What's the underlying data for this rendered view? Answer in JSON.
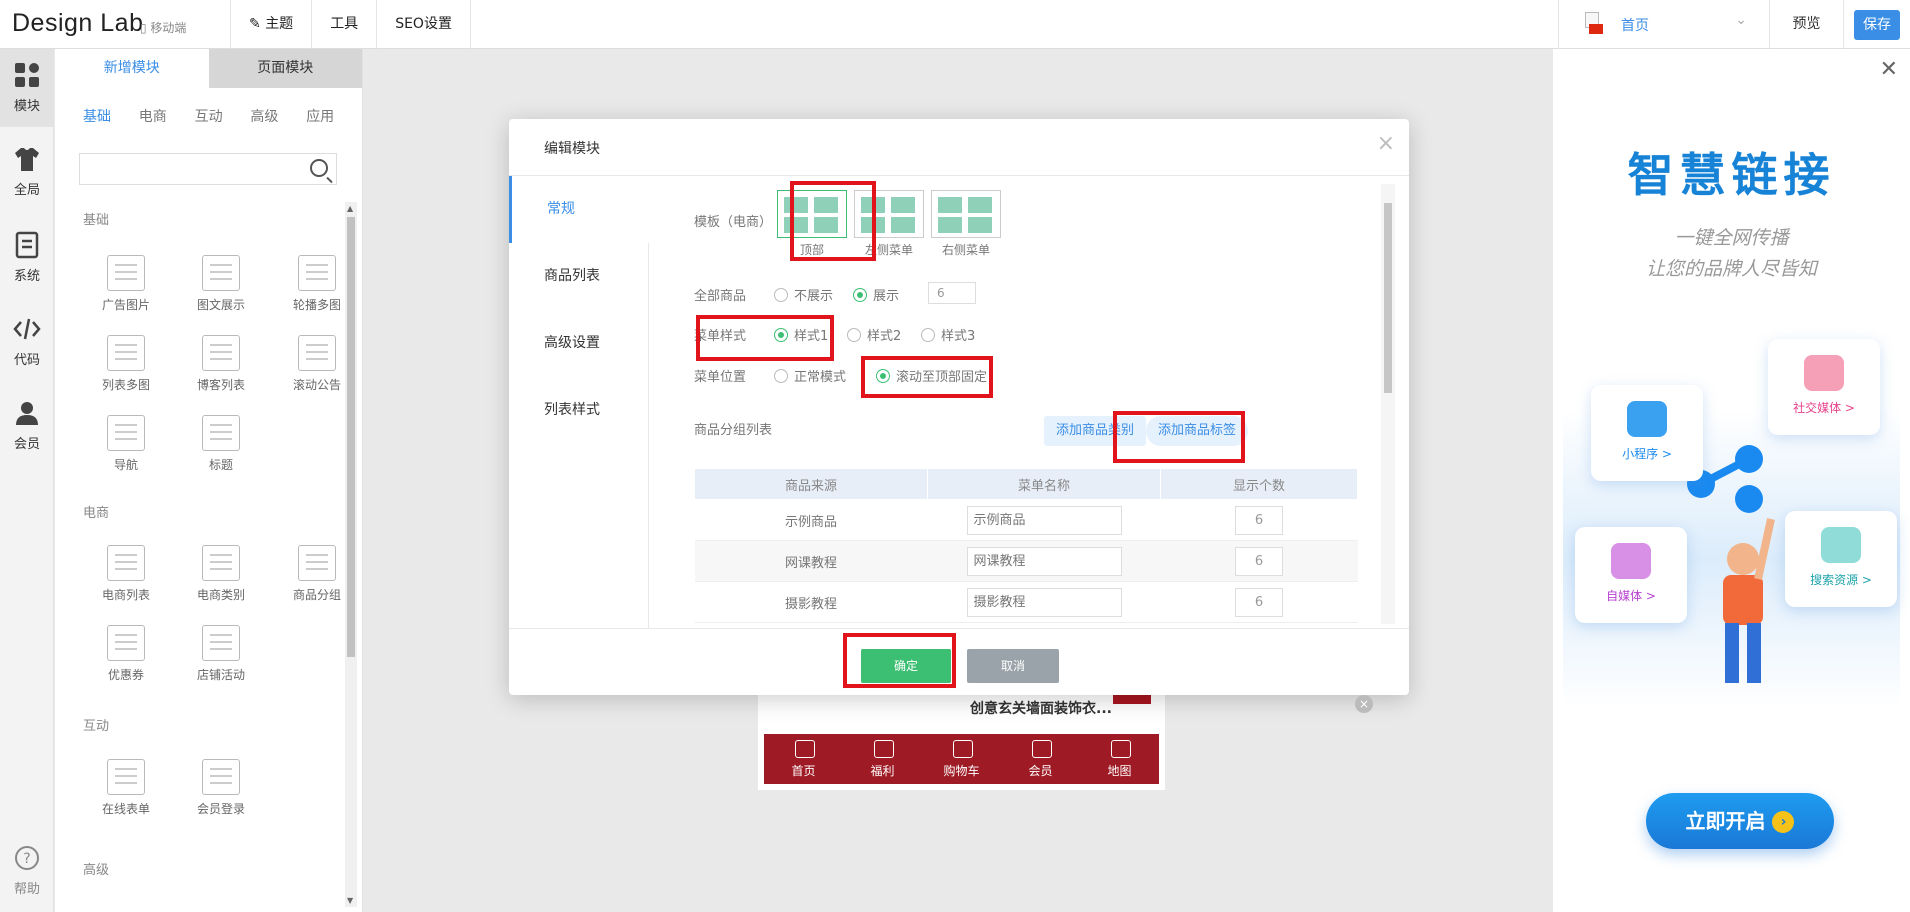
{
  "header": {
    "brand": "Design Lab",
    "mobile_label": "移动端",
    "nav": [
      "主题",
      "工具",
      "SEO设置"
    ],
    "page_select": "首页",
    "preview": "预览",
    "save": "保存"
  },
  "rail": {
    "items": [
      {
        "label": "模块",
        "icon": "grid-icon"
      },
      {
        "label": "全局",
        "icon": "shirt-icon"
      },
      {
        "label": "系统",
        "icon": "document-icon"
      },
      {
        "label": "代码",
        "icon": "code-icon"
      },
      {
        "label": "会员",
        "icon": "user-icon"
      }
    ],
    "help": "帮助"
  },
  "panel": {
    "tabs": [
      "新增模块",
      "页面模块"
    ],
    "subtabs": [
      "基础",
      "电商",
      "互动",
      "高级",
      "应用"
    ],
    "search_placeholder": "",
    "section_basic": "基础",
    "basic_modules": [
      "广告图片",
      "图文展示",
      "轮播多图",
      "列表多图",
      "博客列表",
      "滚动公告",
      "导航",
      "标题"
    ],
    "section_ecom": "电商",
    "ecom_modules": [
      "电商列表",
      "电商类别",
      "商品分组",
      "优惠券",
      "店铺活动"
    ],
    "section_interact": "互动",
    "interact_modules": [
      "在线表单",
      "会员登录"
    ],
    "section_advanced": "高级"
  },
  "phone": {
    "product_title": "创意玄关墙面装饰衣...",
    "bottom_nav": [
      "首页",
      "福利",
      "购物车",
      "会员",
      "地图"
    ]
  },
  "ad": {
    "title": "智慧链接",
    "sub1": "一键全网传播",
    "sub2": "让您的品牌人尽皆知",
    "bubbles": [
      "小程序 >",
      "社交媒体 >",
      "自媒体 >",
      "搜索资源 >"
    ],
    "cta": "立即开启"
  },
  "modal": {
    "title": "编辑模块",
    "side_tabs": [
      "常规",
      "商品列表",
      "高级设置",
      "列表样式"
    ],
    "template_label": "模板（电商）",
    "templates": [
      "顶部",
      "左侧菜单",
      "右侧菜单"
    ],
    "all_products_label": "全部商品",
    "all_products_opts": [
      "不展示",
      "展示"
    ],
    "all_products_count": "6",
    "menu_style_label": "菜单样式",
    "menu_style_opts": [
      "样式1",
      "样式2",
      "样式3"
    ],
    "menu_pos_label": "菜单位置",
    "menu_pos_opts": [
      "正常模式",
      "滚动至顶部固定"
    ],
    "group_list_label": "商品分组列表",
    "add_category": "添加商品类别",
    "add_tag": "添加商品标签",
    "table": {
      "headers": [
        "商品来源",
        "菜单名称",
        "显示个数"
      ],
      "rows": [
        {
          "source": "示例商品",
          "name": "示例商品",
          "count": "6"
        },
        {
          "source": "网课教程",
          "name": "网课教程",
          "count": "6"
        },
        {
          "source": "摄影教程",
          "name": "摄影教程",
          "count": "6"
        }
      ]
    },
    "ok": "确定",
    "cancel": "取消"
  },
  "colors": {
    "accent": "#3a8ee6",
    "ok": "#3cbf73",
    "highlight": "#e2141b",
    "phone_bar": "#9e1a24"
  }
}
